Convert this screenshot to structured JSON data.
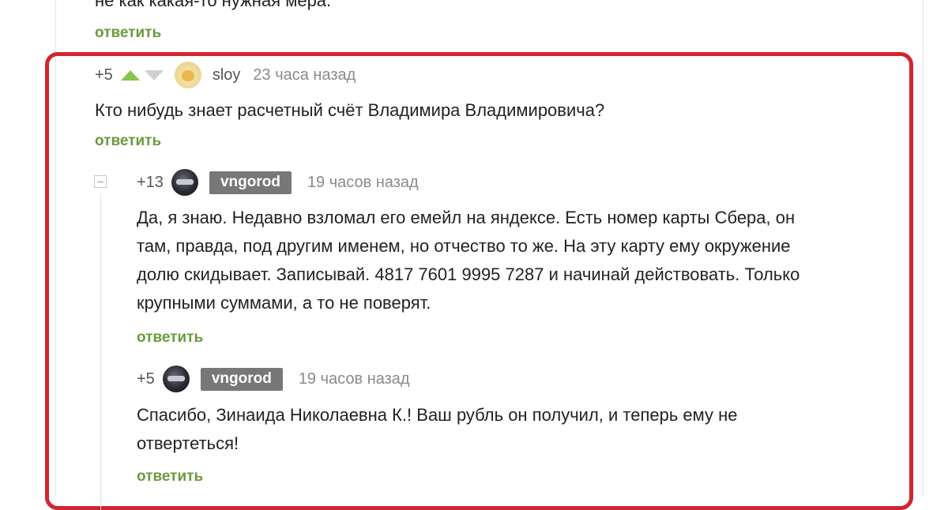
{
  "previous_comment": {
    "text_fragment": "не как какая-то нужная мера.",
    "reply_label": "ответить"
  },
  "comment_root": {
    "rating": "+5",
    "username": "sloy",
    "timestamp": "23 часа назад",
    "text": "Кто нибудь знает расчетный счёт Владимира Владимировича?",
    "reply_label": "ответить"
  },
  "reply_1": {
    "rating": "+13",
    "username": "vngorod",
    "timestamp": "19 часов назад",
    "lines": [
      "Да, я знаю. Недавно взломал его емейл на яндексе. Есть номер карты Сбера, он",
      "там, правда, под другим именем, но отчество то же. На эту карту ему окружение",
      "долю скидывает. Записывай. 4817 7601 9995 7287 и начинай действовать. Только",
      "крупными суммами, а то не поверят."
    ],
    "reply_label": "ответить"
  },
  "reply_2": {
    "rating": "+5",
    "username": "vngorod",
    "timestamp": "19 часов назад",
    "lines": [
      "Спасибо, Зинаида Николаевна К.! Ваш рубль он получил, и теперь ему не",
      "отвертеться!"
    ],
    "reply_label": "ответить"
  },
  "colors": {
    "accent_green": "#6a9a3e",
    "vote_up": "#8ac44d",
    "highlight_red": "#d0262f",
    "badge_gray": "#777777"
  },
  "icons": {
    "vote_up": "triangle-up-icon",
    "vote_down": "triangle-down-icon",
    "collapse": "minus-square-icon"
  }
}
